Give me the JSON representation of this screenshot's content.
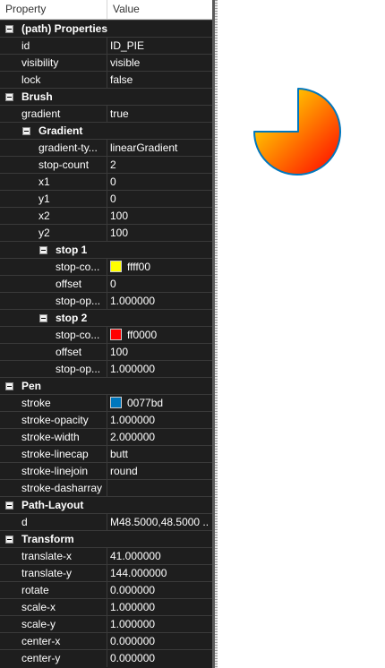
{
  "header": {
    "property": "Property",
    "value": "Value"
  },
  "categories": [
    {
      "label": "(path) Properties",
      "rows": [
        {
          "name": "id",
          "value": "ID_PIE"
        },
        {
          "name": "visibility",
          "value": "visible"
        },
        {
          "name": "lock",
          "value": "false"
        }
      ]
    },
    {
      "label": "Brush",
      "rows": [
        {
          "name": "gradient",
          "value": "true"
        }
      ],
      "sub": {
        "label": "Gradient",
        "rows": [
          {
            "name": "gradient-ty...",
            "value": "linearGradient"
          },
          {
            "name": "stop-count",
            "value": "2"
          },
          {
            "name": "x1",
            "value": "0"
          },
          {
            "name": "y1",
            "value": "0"
          },
          {
            "name": "x2",
            "value": "100"
          },
          {
            "name": "y2",
            "value": "100"
          }
        ],
        "stops": [
          {
            "label": "stop 1",
            "rows": [
              {
                "name": "stop-co...",
                "value": "ffff00",
                "swatch": "#ffff00"
              },
              {
                "name": "offset",
                "value": "0"
              },
              {
                "name": "stop-op...",
                "value": "1.000000"
              }
            ]
          },
          {
            "label": "stop 2",
            "rows": [
              {
                "name": "stop-co...",
                "value": "ff0000",
                "swatch": "#ff0000"
              },
              {
                "name": "offset",
                "value": "100"
              },
              {
                "name": "stop-op...",
                "value": "1.000000"
              }
            ]
          }
        ]
      }
    },
    {
      "label": "Pen",
      "rows": [
        {
          "name": "stroke",
          "value": "0077bd",
          "swatch": "#0077bd"
        },
        {
          "name": "stroke-opacity",
          "value": "1.000000"
        },
        {
          "name": "stroke-width",
          "value": "2.000000"
        },
        {
          "name": "stroke-linecap",
          "value": "butt"
        },
        {
          "name": "stroke-linejoin",
          "value": "round"
        },
        {
          "name": "stroke-dasharray",
          "value": ""
        }
      ]
    },
    {
      "label": "Path-Layout",
      "rows": [
        {
          "name": "d",
          "value": "M48.5000,48.5000 ..."
        }
      ]
    },
    {
      "label": "Transform",
      "rows": [
        {
          "name": "translate-x",
          "value": "41.000000"
        },
        {
          "name": "translate-y",
          "value": "144.000000"
        },
        {
          "name": "rotate",
          "value": "0.000000"
        },
        {
          "name": "scale-x",
          "value": "1.000000"
        },
        {
          "name": "scale-y",
          "value": "1.000000"
        },
        {
          "name": "center-x",
          "value": "0.000000"
        },
        {
          "name": "center-y",
          "value": "0.000000"
        }
      ]
    }
  ],
  "shape": {
    "gradient_start": "#ffff00",
    "gradient_end": "#ff0000",
    "stroke": "#0077bd"
  }
}
